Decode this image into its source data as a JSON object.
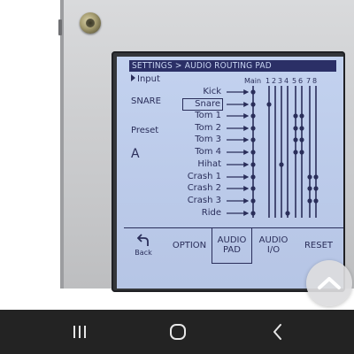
{
  "screen": {
    "title": "SETTINGS > AUDIO ROUTING PAD",
    "input_label": "Input",
    "instrument": "SNARE",
    "preset_label": "Preset",
    "preset_value": "A"
  },
  "routing": {
    "column_main": "Main",
    "column_numbers": [
      "1",
      "2",
      "3",
      "4",
      "5",
      "6",
      "7",
      "8"
    ],
    "rows": [
      "Kick",
      "Snare",
      "Tom 1",
      "Tom 2",
      "Tom 3",
      "Tom 4",
      "Hihat",
      "Crash 1",
      "Crash 2",
      "Crash 3",
      "Ride"
    ],
    "selected_row": "Snare"
  },
  "softkeys": {
    "back": "Back",
    "option": "OPTION",
    "audio_pad_line1": "AUDIO",
    "audio_pad_line2": "PAD",
    "audio_io_line1": "AUDIO",
    "audio_io_line2": "I/O",
    "reset": "RESET"
  },
  "colors": {
    "lcd_background": "#bccbea",
    "lcd_ink": "#2a2e5a",
    "title_bar": "#2b2f66",
    "navbar": "#232323"
  },
  "icons": {
    "back": "back-arrow-icon",
    "scroll_top": "chevron-up-icon",
    "nav_recents": "recents-icon",
    "nav_home": "home-icon",
    "nav_back": "nav-back-icon"
  }
}
